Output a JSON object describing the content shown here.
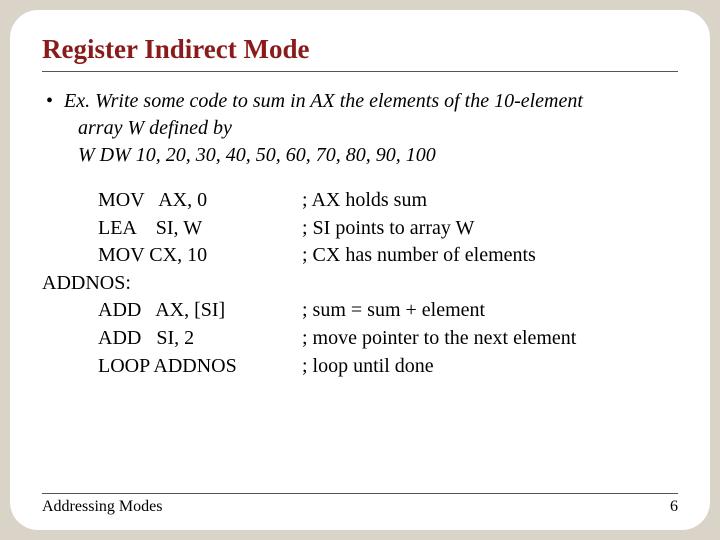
{
  "title": "Register Indirect Mode",
  "prompt": {
    "line1": "Ex. Write some code to sum in AX the elements of the 10-element",
    "line2": "array W defined by",
    "line3": "W DW   10, 20, 30, 40, 50, 60, 70, 80, 90, 100"
  },
  "code": [
    {
      "indent": true,
      "left": "MOV   AX, 0",
      "right": "; AX holds sum"
    },
    {
      "indent": true,
      "left": "LEA    SI, W",
      "right": "; SI points to array W"
    },
    {
      "indent": true,
      "left": "MOV CX, 10",
      "right": "; CX has number of elements"
    },
    {
      "indent": false,
      "left": "ADDNOS:",
      "right": ""
    },
    {
      "indent": true,
      "left": "ADD   AX, [SI]",
      "right": "; sum = sum + element"
    },
    {
      "indent": true,
      "left": "ADD   SI, 2",
      "right": "; move pointer to the next element"
    },
    {
      "indent": true,
      "left": "LOOP ADDNOS",
      "right": "; loop until done"
    }
  ],
  "footer": {
    "left": "Addressing Modes",
    "right": "6"
  }
}
